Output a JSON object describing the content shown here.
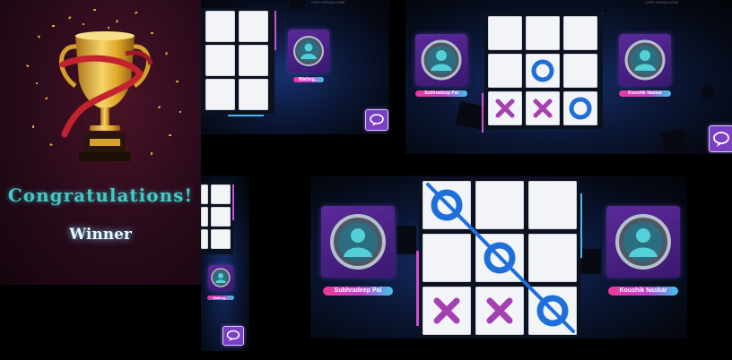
{
  "winner_panel": {
    "heading": "Congratulations!",
    "subheading": "Winner",
    "icon": "trophy-icon",
    "colors": {
      "heading": "#41c9c4",
      "subheading": "#e4faff",
      "trophy": "#e3a92a",
      "ribbon": "#c2232f"
    }
  },
  "top_screen": {
    "room_code_label": "COPY ROOM CODE",
    "players": [
      {
        "name": "Subhradeep Pal",
        "avatar": "user-icon"
      },
      {
        "name": "Koushik Naskar",
        "avatar": "user-icon"
      }
    ],
    "board": [
      "",
      "",
      "",
      "",
      "O",
      "",
      "X",
      "X",
      "O"
    ]
  },
  "waiting_screen": {
    "room_code_label": "COPY ROOM CODE",
    "player_label": "Waiting..."
  },
  "final_screen": {
    "players": [
      {
        "name": "Subhradeep Pal",
        "avatar": "user-icon"
      },
      {
        "name": "Koushik Naskar",
        "avatar": "user-icon"
      }
    ],
    "board": [
      "O",
      "",
      "",
      "",
      "O",
      "",
      "X",
      "X",
      "O"
    ],
    "winning_line": "diagonal top-left to bottom-right"
  },
  "colors": {
    "x_mark": "#a440b2",
    "o_mark": "#1e6fd9",
    "tag_start": "#e83c9a",
    "tag_end": "#3fc8e8",
    "chat_button": "#7b3fc4"
  }
}
